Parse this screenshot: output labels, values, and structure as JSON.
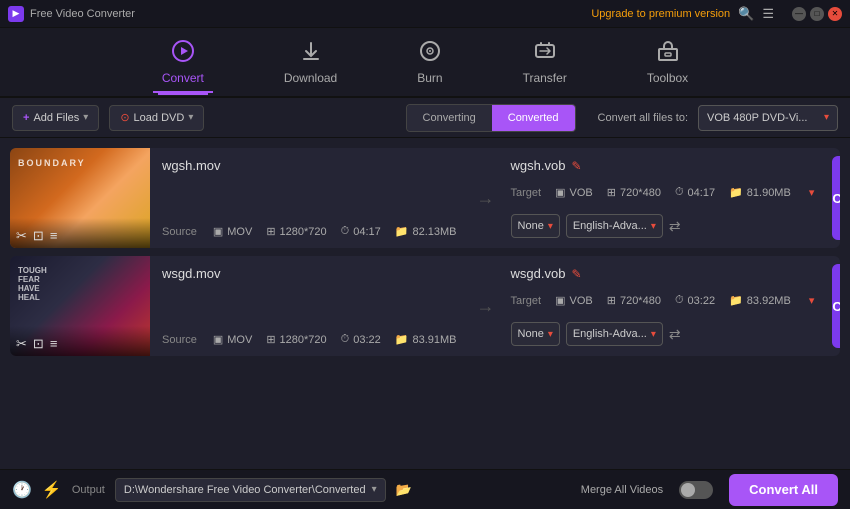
{
  "app": {
    "title": "Free Video Converter",
    "upgrade_label": "Upgrade to premium version"
  },
  "nav": {
    "items": [
      {
        "id": "convert",
        "label": "Convert",
        "icon": "▶",
        "active": true
      },
      {
        "id": "download",
        "label": "Download",
        "icon": "⬇",
        "active": false
      },
      {
        "id": "burn",
        "label": "Burn",
        "icon": "⏺",
        "active": false
      },
      {
        "id": "transfer",
        "label": "Transfer",
        "icon": "⇄",
        "active": false
      },
      {
        "id": "toolbox",
        "label": "Toolbox",
        "icon": "▦",
        "active": false
      }
    ]
  },
  "toolbar": {
    "add_files": "+ Add Files",
    "load_dvd": "⊙ Load DVD",
    "tab_converting": "Converting",
    "tab_converted": "Converted",
    "convert_all_label": "Convert all files to:",
    "format_value": "VOB 480P DVD-Vi..."
  },
  "files": [
    {
      "id": "file1",
      "source_name": "wgsh.mov",
      "target_name": "wgsh.vob",
      "source_format": "MOV",
      "source_res": "1280*720",
      "source_dur": "04:17",
      "source_size": "82.13MB",
      "target_format": "VOB",
      "target_res": "720*480",
      "target_dur": "04:17",
      "target_size": "81.90MB",
      "subtitle": "None",
      "audio": "English-Adva...",
      "thumb_class": "thumb-1",
      "thumb_label": "BOUNDARY"
    },
    {
      "id": "file2",
      "source_name": "wsgd.mov",
      "target_name": "wsgd.vob",
      "source_format": "MOV",
      "source_res": "1280*720",
      "source_dur": "03:22",
      "source_size": "83.91MB",
      "target_format": "VOB",
      "target_res": "720*480",
      "target_dur": "03:22",
      "target_size": "83.92MB",
      "subtitle": "None",
      "audio": "English-Adva...",
      "thumb_class": "thumb-2",
      "thumb_label": "FEAR"
    }
  ],
  "bottom": {
    "output_label": "Output",
    "output_path": "D:\\Wondershare Free Video Converter\\Converted",
    "merge_label": "Merge All Videos",
    "convert_all_btn": "Convert All"
  },
  "buttons": {
    "convert_label": "Convert"
  }
}
